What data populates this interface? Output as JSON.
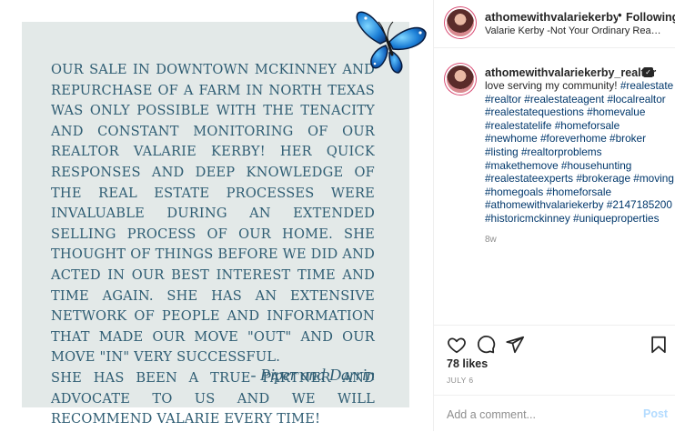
{
  "post": {
    "quote_paragraphs": [
      "Our sale in downtown McKinney and repurchase of a farm in North Texas was only possible with the tenacity and constant monitoring of our Realtor Valarie Kerby! Her quick responses and deep knowledge of the real estate processes were invaluable during an extended selling process of our home. She thought of things before we did and acted in our best interest time and time again. She has an extensive network of people and information that made our move \"out\" and our move \"in\" very successful.",
      "She has been a true partner and advocate to us and we will recommend Valarie every time!"
    ],
    "signature": "- Piper and Darrin",
    "card_color": "#e3e9e8",
    "text_color": "#2f5d73"
  },
  "header": {
    "username": "athomewithvalariekerby_realtor",
    "separator": "•",
    "follow_status": "Following",
    "subtitle": "Valarie Kerby -Not Your Ordinary Real Estate Agent"
  },
  "caption": {
    "username": "athomewithvalariekerby_realtor",
    "verified_icon": "badge-icon",
    "lead": "love serving my community! ",
    "hashtags": "#realestate #realtor #realestateagent #localrealtor #realestatequestions #homevalue #realestatelife #homeforsale #newhome #foreverhome #broker #listing #realtorproblems #makethemove #househunting #realestateexperts #brokerage #moving #homegoals #homeforsale #athomewithvalariekerby #2147185200 #historicmckinney #uniqueproperties",
    "time_ago": "8w"
  },
  "actions": {
    "like_icon": "heart-icon",
    "comment_icon": "comment-icon",
    "share_icon": "send-icon",
    "save_icon": "bookmark-icon"
  },
  "stats": {
    "likes": "78 likes",
    "date": "JULY 6"
  },
  "comment": {
    "placeholder": "Add a comment...",
    "post_label": "Post",
    "link_color": "#00376b",
    "post_button_color": "#b3dbff"
  }
}
